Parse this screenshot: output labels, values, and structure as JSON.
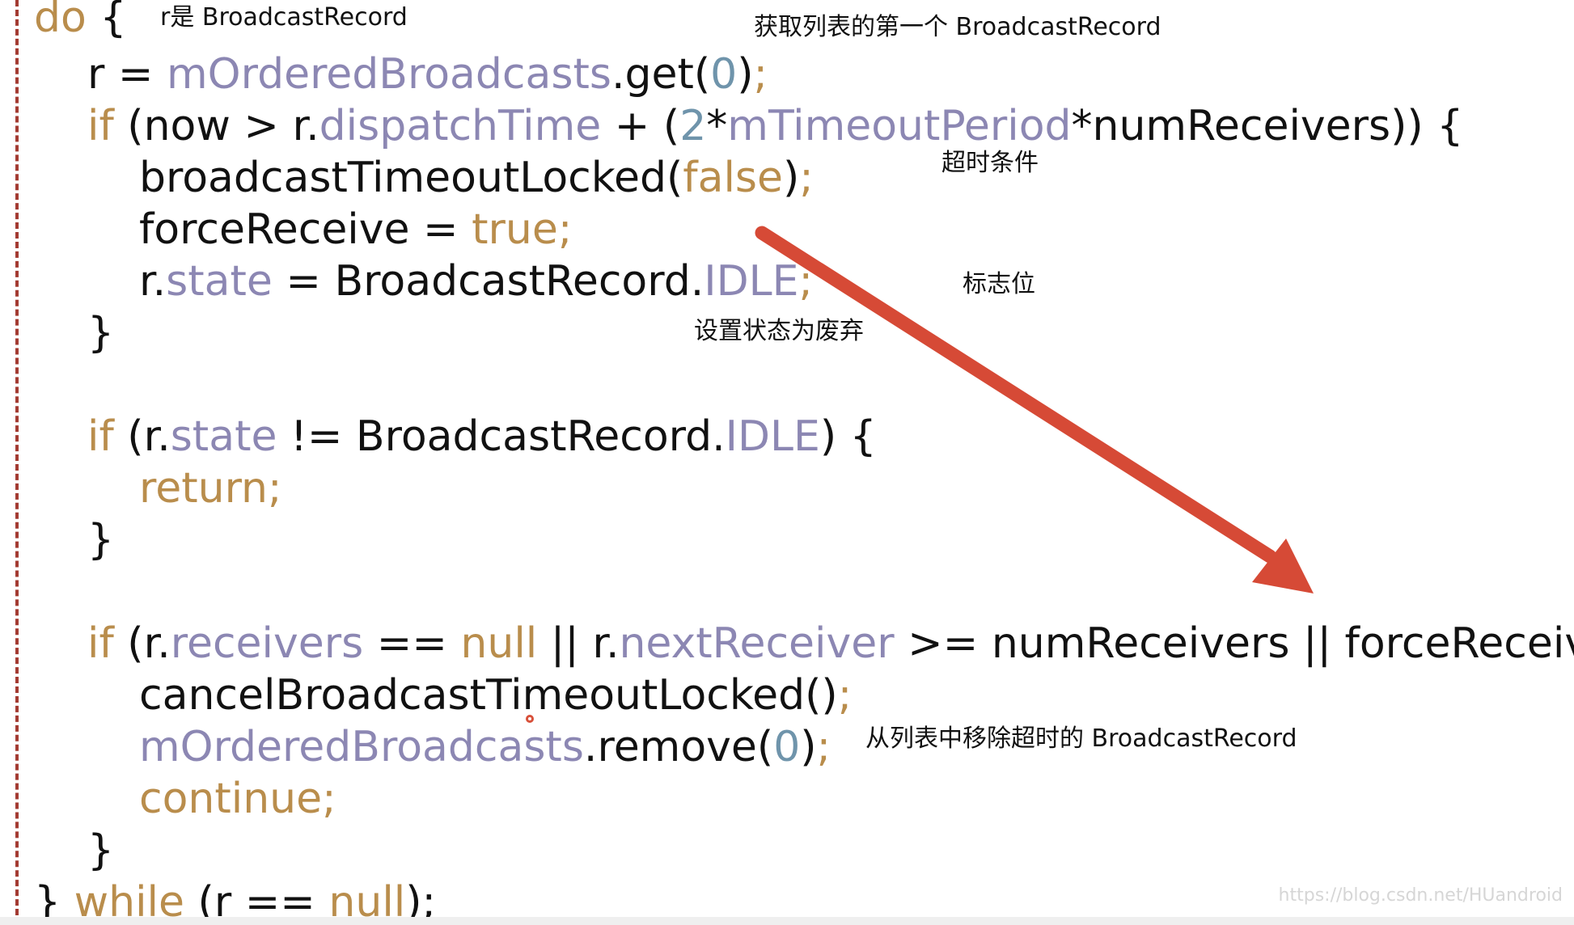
{
  "colors": {
    "plain": "#111111",
    "keyword": "#b98d4c",
    "field": "#8c87b3",
    "number": "#6f94ab",
    "arrow": "#d64a36",
    "gutter": "#a33b32"
  },
  "code": [
    [
      {
        "t": "do ",
        "c": "keyword"
      },
      {
        "t": "{",
        "c": "plain"
      }
    ],
    [
      {
        "t": "r = ",
        "c": "plain"
      },
      {
        "t": "mOrderedBroadcasts",
        "c": "field"
      },
      {
        "t": ".get(",
        "c": "plain"
      },
      {
        "t": "0",
        "c": "number"
      },
      {
        "t": ")",
        "c": "plain"
      },
      {
        "t": ";",
        "c": "keyword"
      }
    ],
    [
      {
        "t": "if ",
        "c": "keyword"
      },
      {
        "t": "(now > r.",
        "c": "plain"
      },
      {
        "t": "dispatchTime",
        "c": "field"
      },
      {
        "t": " + (",
        "c": "plain"
      },
      {
        "t": "2",
        "c": "number"
      },
      {
        "t": "*",
        "c": "plain"
      },
      {
        "t": "mTimeoutPeriod",
        "c": "field"
      },
      {
        "t": "*numReceivers)) {",
        "c": "plain"
      }
    ],
    [
      {
        "t": "broadcastTimeoutLocked(",
        "c": "plain"
      },
      {
        "t": "false",
        "c": "keyword"
      },
      {
        "t": ")",
        "c": "plain"
      },
      {
        "t": ";",
        "c": "keyword"
      }
    ],
    [
      {
        "t": "forceReceive = ",
        "c": "plain"
      },
      {
        "t": "true;",
        "c": "keyword"
      }
    ],
    [
      {
        "t": "r.",
        "c": "plain"
      },
      {
        "t": "state",
        "c": "field"
      },
      {
        "t": " = BroadcastRecord.",
        "c": "plain"
      },
      {
        "t": "IDLE",
        "c": "field"
      },
      {
        "t": ";",
        "c": "keyword"
      }
    ],
    [
      {
        "t": "}",
        "c": "plain"
      }
    ],
    [
      {
        "t": "if ",
        "c": "keyword"
      },
      {
        "t": "(r.",
        "c": "plain"
      },
      {
        "t": "state",
        "c": "field"
      },
      {
        "t": " != BroadcastRecord.",
        "c": "plain"
      },
      {
        "t": "IDLE",
        "c": "field"
      },
      {
        "t": ") {",
        "c": "plain"
      }
    ],
    [
      {
        "t": "return;",
        "c": "keyword"
      }
    ],
    [
      {
        "t": "}",
        "c": "plain"
      }
    ],
    [
      {
        "t": "if ",
        "c": "keyword"
      },
      {
        "t": "(r.",
        "c": "plain"
      },
      {
        "t": "receivers",
        "c": "field"
      },
      {
        "t": " == ",
        "c": "plain"
      },
      {
        "t": "null",
        "c": "keyword"
      },
      {
        "t": " || r.",
        "c": "plain"
      },
      {
        "t": "nextReceiver",
        "c": "field"
      },
      {
        "t": " >= numReceivers || forceReceive) {",
        "c": "plain"
      }
    ],
    [
      {
        "t": "cancelBroadcastTimeoutLocked()",
        "c": "plain"
      },
      {
        "t": ";",
        "c": "keyword"
      }
    ],
    [
      {
        "t": "mOrderedBroadcasts",
        "c": "field"
      },
      {
        "t": ".remove(",
        "c": "plain"
      },
      {
        "t": "0",
        "c": "number"
      },
      {
        "t": ")",
        "c": "plain"
      },
      {
        "t": ";",
        "c": "keyword"
      }
    ],
    [
      {
        "t": "continue;",
        "c": "keyword"
      }
    ],
    [
      {
        "t": "}",
        "c": "plain"
      }
    ],
    [
      {
        "t": "} ",
        "c": "plain"
      },
      {
        "t": "while ",
        "c": "keyword"
      },
      {
        "t": "(r == ",
        "c": "plain"
      },
      {
        "t": "null",
        "c": "keyword"
      },
      {
        "t": ");",
        "c": "plain"
      }
    ]
  ],
  "annotations": {
    "r_is": "r是 BroadcastRecord",
    "get_first": "获取列表的第一个 BroadcastRecord",
    "timeout_condition": "超时条件",
    "flag": "标志位",
    "set_discarded": "设置状态为废弃",
    "remove_timeout": "从列表中移除超时的 BroadcastRecord"
  },
  "watermark": "https://blog.csdn.net/HUandroid"
}
